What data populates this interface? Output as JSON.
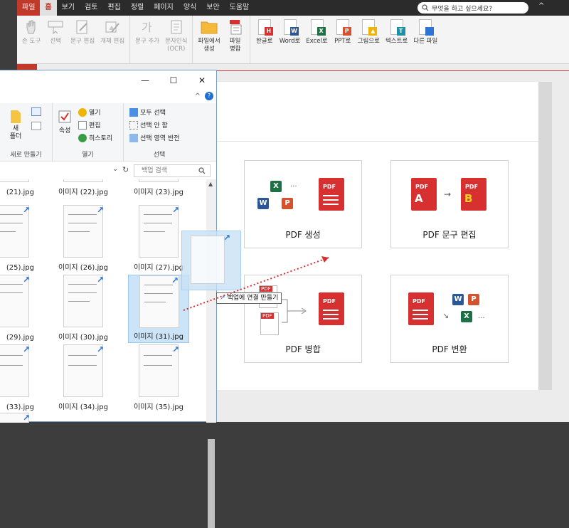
{
  "menubar": {
    "items": [
      "파일",
      "홈",
      "보기",
      "검토",
      "편집",
      "정렬",
      "페이지",
      "양식",
      "보안",
      "도움말"
    ],
    "search_placeholder": "무엇을 하고 싶으세요?"
  },
  "ribbon": {
    "group1": [
      "손 도구",
      "선택",
      "문구 편집",
      "개체 편집"
    ],
    "group2_add_text": "문구 추가",
    "group2_ocr_line1": "문자인식",
    "group2_ocr_line2": "(OCR)",
    "group3_create_line1": "파일에서",
    "group3_create_line2": "생성",
    "group3_merge_line1": "파일",
    "group3_merge_line2": "병합",
    "convert": [
      {
        "label": "한글로",
        "badge": "H",
        "color": "#d63031"
      },
      {
        "label": "Word로",
        "badge": "W",
        "color": "#2b5797"
      },
      {
        "label": "Excel로",
        "badge": "X",
        "color": "#1e7145"
      },
      {
        "label": "PPT로",
        "badge": "P",
        "color": "#d35230"
      },
      {
        "label": "그림으로",
        "badge": "▲",
        "color": "#f0b400"
      },
      {
        "label": "텍스트로",
        "badge": "T",
        "color": "#1e8fa6"
      },
      {
        "label": "다른 파일",
        "badge": "",
        "color": "#2e74d6"
      }
    ]
  },
  "cards": {
    "create": "PDF 생성",
    "edit": "PDF 문구 편집",
    "merge": "PDF 병합",
    "convert": "PDF 변환",
    "pdf_label": "PDF",
    "ellipsis": "...",
    "edit_a": "A",
    "edit_b": "B",
    "word_badge": "W",
    "excel_badge": "X",
    "ppt_badge": "P",
    "arrow_right": "→",
    "arrow_down": "↘"
  },
  "explorer": {
    "minimize": "—",
    "maximize": "☐",
    "close": "✕",
    "new_folder_line1": "새",
    "new_folder_line2": "폴더",
    "group_new": "새로 만들기",
    "properties": "속성",
    "open": "열기",
    "edit": "편집",
    "history": "히스토리",
    "group_open": "열기",
    "select_all": "모두 선택",
    "select_none": "선택 안 함",
    "invert_selection": "선택 영역 반전",
    "group_select": "선택",
    "search_placeholder": "백업 검색",
    "refresh": "↻",
    "chevron_down": "⌄",
    "help": "?",
    "collapse": "^",
    "files": [
      "(21).jpg",
      "이미지 (22).jpg",
      "이미지 (23).jpg",
      "(25).jpg",
      "이미지 (26).jpg",
      "이미지 (27).jpg",
      "(29).jpg",
      "이미지 (30).jpg",
      "이미지 (31).jpg",
      "(33).jpg",
      "이미지 (34).jpg",
      "이미지 (35).jpg"
    ]
  },
  "drag": {
    "tooltip": "백업에 연결 만들기",
    "tooltip_icon": "↗"
  },
  "ribbon_collapse": "^"
}
